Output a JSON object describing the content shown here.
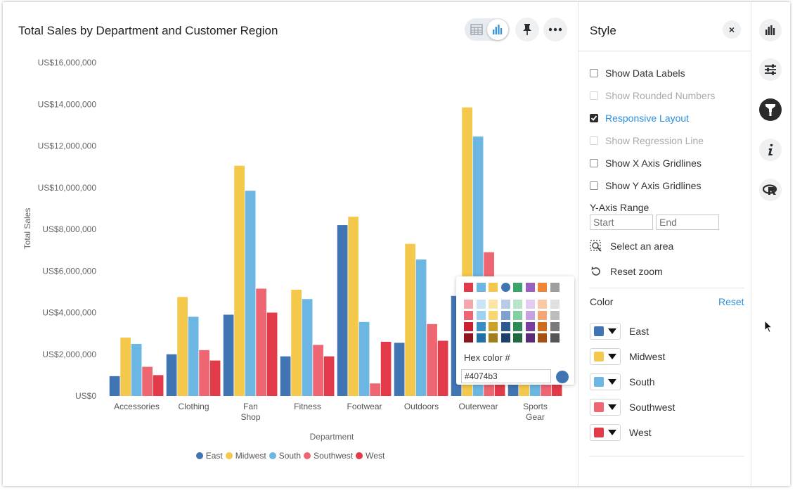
{
  "chart_title": "Total Sales by Department and Customer Region",
  "toolbar": {
    "table_icon": "table-icon",
    "chart_icon": "bar-chart-icon",
    "pin_icon": "pin-icon",
    "more_icon": "more-icon"
  },
  "chart_data": {
    "type": "bar",
    "title": "Total Sales by Department and Customer Region",
    "xlabel": "Department",
    "ylabel": "Total Sales",
    "ylim": [
      0,
      16000000
    ],
    "yticks": [
      0,
      2000000,
      4000000,
      6000000,
      8000000,
      10000000,
      12000000,
      14000000,
      16000000
    ],
    "ytick_labels": [
      "US$0",
      "US$2,000,000",
      "US$4,000,000",
      "US$6,000,000",
      "US$8,000,000",
      "US$10,000,000",
      "US$12,000,000",
      "US$14,000,000",
      "US$16,000,000"
    ],
    "categories": [
      "Accessories",
      "Clothing",
      "Fan Shop",
      "Fitness",
      "Footwear",
      "Outdoors",
      "Outerwear",
      "Sports Gear"
    ],
    "category_labels": [
      [
        "Accessories"
      ],
      [
        "Clothing"
      ],
      [
        "Fan",
        "Shop"
      ],
      [
        "Fitness"
      ],
      [
        "Footwear"
      ],
      [
        "Outdoors"
      ],
      [
        "Outerwear"
      ],
      [
        "Sports",
        "Gear"
      ]
    ],
    "grid": false,
    "legend_position": "bottom",
    "series": [
      {
        "name": "East",
        "color": "#4074b3",
        "values": [
          950000,
          2000000,
          3900000,
          1900000,
          8200000,
          2550000,
          4800000,
          4000000
        ]
      },
      {
        "name": "Midwest",
        "color": "#f4c84a",
        "values": [
          2800000,
          4750000,
          11050000,
          5100000,
          8600000,
          7300000,
          13850000,
          3700000
        ]
      },
      {
        "name": "South",
        "color": "#6bb6e2",
        "values": [
          2500000,
          3800000,
          9850000,
          4650000,
          3550000,
          6550000,
          12450000,
          3500000
        ]
      },
      {
        "name": "Southwest",
        "color": "#ee6672",
        "values": [
          1400000,
          2200000,
          5150000,
          2450000,
          600000,
          3450000,
          6900000,
          2800000
        ]
      },
      {
        "name": "West",
        "color": "#e23a48",
        "values": [
          1000000,
          1700000,
          4000000,
          1900000,
          2600000,
          2650000,
          4000000,
          2600000
        ]
      }
    ]
  },
  "color_picker": {
    "hex_label": "Hex color #",
    "hex_value": "#4074b3",
    "top_row": [
      "#e23a48",
      "#6bb6e2",
      "#f4c84a",
      "#4074b3",
      "#3aa56a",
      "#9b5fc0",
      "#f08537",
      "#9e9e9e"
    ],
    "grid": [
      [
        "#f4a6ad",
        "#c9e5f6",
        "#fbe6a8",
        "#b8cbe6",
        "#b8e4c9",
        "#e2cdf0",
        "#f9c9a6",
        "#e0e0e0"
      ],
      [
        "#ee6672",
        "#9ed2f0",
        "#f7d574",
        "#7fa1d1",
        "#82cfa3",
        "#c7a2e2",
        "#f4a673",
        "#bdbdbd"
      ],
      [
        "#c8202e",
        "#3a8ec6",
        "#c9a227",
        "#2c5a93",
        "#2e8a57",
        "#7a3ea0",
        "#d26a1e",
        "#7a7a7a"
      ],
      [
        "#8e1520",
        "#1f6fa8",
        "#a07f1a",
        "#1d3f6b",
        "#1f6a40",
        "#5a2a7a",
        "#a64f12",
        "#555555"
      ]
    ]
  },
  "style_panel": {
    "title": "Style",
    "close_label": "×",
    "checkboxes": [
      {
        "label": "Show Data Labels",
        "checked": false,
        "disabled": false
      },
      {
        "label": "Show Rounded Numbers",
        "checked": false,
        "disabled": true
      },
      {
        "label": "Responsive Layout",
        "checked": true,
        "disabled": false
      },
      {
        "label": "Show Regression Line",
        "checked": false,
        "disabled": true
      },
      {
        "label": "Show X Axis Gridlines",
        "checked": false,
        "disabled": false
      },
      {
        "label": "Show Y Axis Gridlines",
        "checked": false,
        "disabled": false
      }
    ],
    "y_axis_range": {
      "label": "Y-Axis Range",
      "start_placeholder": "Start",
      "end_placeholder": "End"
    },
    "select_area": "Select an area",
    "reset_zoom": "Reset zoom",
    "color_title": "Color",
    "reset_label": "Reset",
    "colors": [
      {
        "name": "East",
        "color": "#4074b3"
      },
      {
        "name": "Midwest",
        "color": "#f4c84a"
      },
      {
        "name": "South",
        "color": "#6bb6e2"
      },
      {
        "name": "Southwest",
        "color": "#ee6672"
      },
      {
        "name": "West",
        "color": "#e23a48"
      }
    ]
  },
  "side_rail": [
    "bar-chart-icon",
    "settings-sliders-icon",
    "paint-brush-icon",
    "info-icon",
    "r-script-icon"
  ]
}
